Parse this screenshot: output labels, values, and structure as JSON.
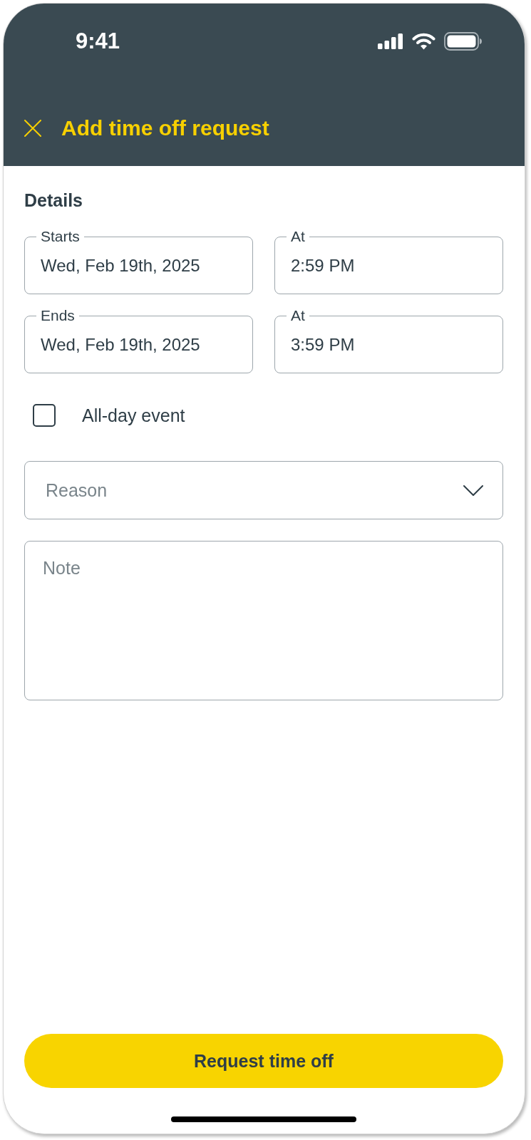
{
  "status_bar": {
    "time": "9:41"
  },
  "header": {
    "title": "Add time off request"
  },
  "details": {
    "heading": "Details",
    "fields": [
      {
        "label": "Starts",
        "value": "Wed, Feb 19th, 2025"
      },
      {
        "label": "At",
        "value": "2:59 PM"
      },
      {
        "label": "Ends",
        "value": "Wed, Feb 19th, 2025"
      },
      {
        "label": "At",
        "value": "3:59 PM"
      }
    ]
  },
  "all_day": {
    "label": "All-day event",
    "checked": false
  },
  "reason": {
    "placeholder": "Reason"
  },
  "note": {
    "placeholder": "Note"
  },
  "submit_button": {
    "label": "Request time off"
  }
}
